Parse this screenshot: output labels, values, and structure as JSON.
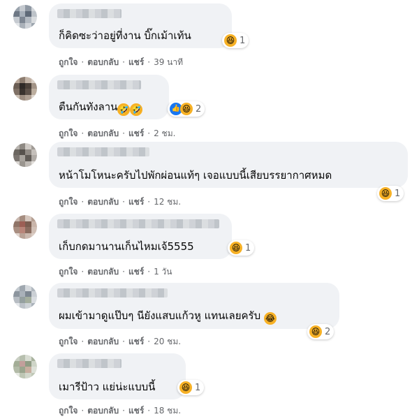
{
  "labels": {
    "like": "ถูกใจ",
    "reply": "ตอบกลับ",
    "share": "แชร์",
    "separator": "·"
  },
  "comments": [
    {
      "text": "ก็คิดซะว่าอยู่ที่งาน บิ๊กเม้าเท้น",
      "reaction_count": "1",
      "reaction_icons": [
        "haha-icon"
      ],
      "time": "39 นาที"
    },
    {
      "text": "ตืนกันทังลาน",
      "reaction_count": "2",
      "reaction_icons": [
        "like-icon",
        "haha-icon"
      ],
      "time": "2 ชม."
    },
    {
      "text": "หน้าโมโหนะครับไปพักผ่อนแท้ๆ เจอแบบนี้เสียบรรยากาศหมด",
      "reaction_count": "1",
      "reaction_icons": [
        "haha-icon"
      ],
      "time": "12 ชม."
    },
    {
      "text": "เก็บกดมานานเก็นไหมเจ้5555",
      "reaction_count": "1",
      "reaction_icons": [
        "haha-icon"
      ],
      "time": "1 วัน"
    },
    {
      "text": "ผมเข้ามาดูแป๊บๆ นียังแสบแก้วหู แทนเลยครับ",
      "reaction_count": "2",
      "reaction_icons": [
        "haha-icon"
      ],
      "time": "20 ชม."
    },
    {
      "text": "เมารีป้าว แย่น่ะแบบนี้",
      "reaction_count": "1",
      "reaction_icons": [
        "haha-icon"
      ],
      "time": "18 ชม."
    }
  ],
  "colors": {
    "bubble": "#f0f2f5",
    "meta_text": "#65676b",
    "haha": "#f7b125",
    "like": "#1877f2"
  }
}
